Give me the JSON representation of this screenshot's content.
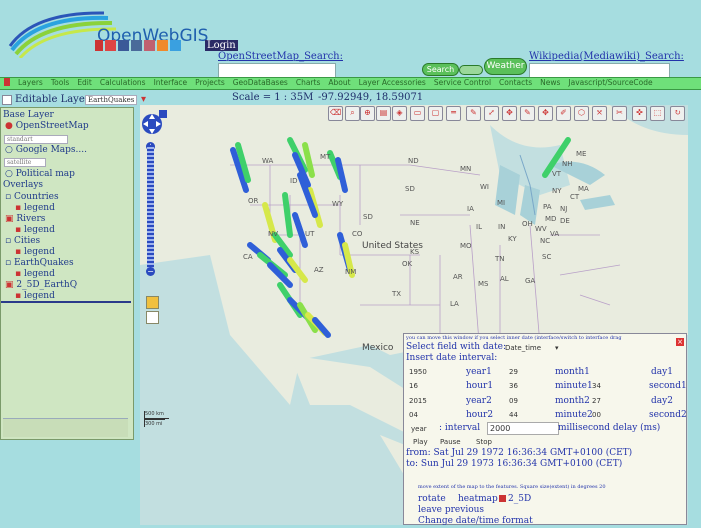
{
  "header": {
    "logo_text": "OpenWebGIS",
    "login_label": "Login",
    "osm_search_label": "OpenStreetMap_Search:",
    "wiki_search_label": "Wikipedia(Mediawiki)_Search:",
    "search_button": "Search",
    "weather_button": "Weather"
  },
  "menu": {
    "items": [
      "Layers",
      "Tools",
      "Edit",
      "Calculations",
      "Interface",
      "Projects",
      "GeoDataBases",
      "Charts",
      "About",
      "Layer Accessories",
      "Service Control",
      "Contacts",
      "News",
      "Javascript/SourceCode"
    ]
  },
  "status": {
    "editable_layer_label": "Editable Layer:",
    "editable_layer_value": "EarthQuakes",
    "scale": "Scale = 1 : 35M",
    "coords": "-97.92949, 18.59071"
  },
  "layers_panel": {
    "base_layer_title": "Base Layer",
    "openstreetmap": "OpenStreetMap",
    "standart": "standart",
    "google_maps": "Google Maps....",
    "satellite": "satellite",
    "political_map": "Political map",
    "overlays_title": "Overlays",
    "overlays": [
      {
        "label": "Countries",
        "legend": "legend"
      },
      {
        "label": "Rivers",
        "legend": "legend"
      },
      {
        "label": "Cities",
        "legend": "legend"
      },
      {
        "label": "EarthQuakes",
        "legend": "legend"
      },
      {
        "label": "2_5D_EarthQ",
        "legend": "legend"
      }
    ]
  },
  "map": {
    "state_labels": [
      "WA",
      "MT",
      "ND",
      "MN",
      "OR",
      "ID",
      "SD",
      "WY",
      "NE",
      "IA",
      "NV",
      "UT",
      "CO",
      "KS",
      "MO",
      "CA",
      "AZ",
      "NM",
      "OK",
      "AR",
      "TX",
      "LA",
      "MS",
      "AL",
      "GA",
      "SC",
      "NC",
      "TN",
      "KY",
      "IL",
      "IN",
      "OH",
      "WV",
      "VA",
      "MI",
      "WI",
      "PA",
      "NY",
      "VT",
      "NH",
      "ME",
      "MD",
      "DE",
      "NJ",
      "CT",
      "MA",
      "SD"
    ],
    "country_labels": [
      "United States",
      "Mexico"
    ],
    "scale_km": "500 km",
    "scale_mi": "300 mi"
  },
  "date_dialog": {
    "hint": "you can move this window if you select inner date (interface/switch to interface drag",
    "select_field_label": "Select field with date:",
    "select_field_value": "Date_time",
    "insert_interval_label": "Insert date interval:",
    "rows": [
      {
        "v1": "1950",
        "l1": "year1",
        "v2": "29",
        "l2": "month1",
        "v3": "",
        "l3": "day1"
      },
      {
        "v1": "16",
        "l1": "hour1",
        "v2": "36",
        "l2": "minute1",
        "v3": "34",
        "l3": "second1"
      },
      {
        "v1": "2015",
        "l1": "year2",
        "v2": "09",
        "l2": "month2",
        "v3": "27",
        "l3": "day2"
      },
      {
        "v1": "04",
        "l1": "hour2",
        "v2": "44",
        "l2": "minute2",
        "v3": "00",
        "l3": "second2"
      }
    ],
    "year_label": "year",
    "interval_label": ": interval",
    "interval_value": "2000",
    "delay_label": "millisecond delay (ms)",
    "play": "Play",
    "pause": "Pause",
    "stop": "Stop",
    "from_text": "from: Sat Jul 29 1972 16:36:34 GMT+0100 (CET)",
    "to_text": "to: Sun Jul 29 1973 16:36:34 GMT+0100 (CET)",
    "move_extent": "move extent of the map to the features. Square size(extent) in degrees 20",
    "rotate": "rotate",
    "heatmap": "heatmap",
    "label_2_5d": "2_5D",
    "leave_previous": "leave previous",
    "change_format": "Change date/time format"
  }
}
